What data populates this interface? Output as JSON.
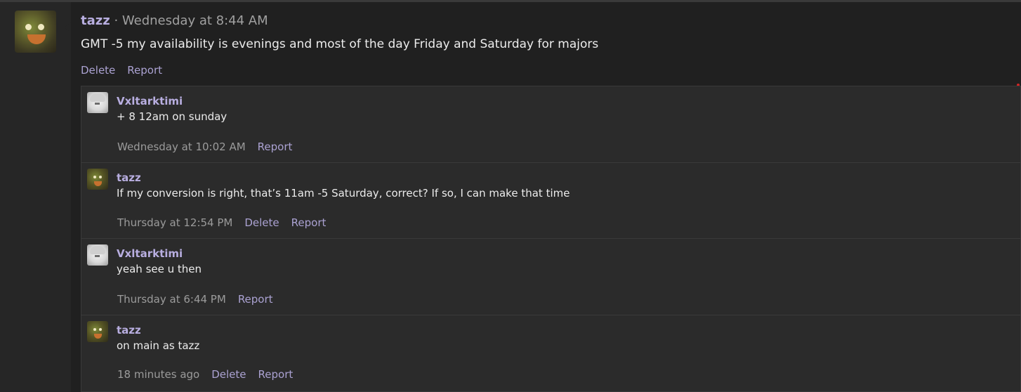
{
  "post": {
    "author": "tazz",
    "separator": " · ",
    "time": "Wednesday at 8:44 AM",
    "text": "GMT -5 my availability is evenings and most of the day Friday and Saturday for majors",
    "actions": {
      "delete": "Delete",
      "report": "Report"
    }
  },
  "replies": [
    {
      "author": "Vxltarktimi",
      "text": " + 8 12am on sunday",
      "time": "Wednesday at 10:02 AM",
      "report": "Report"
    },
    {
      "author": "tazz",
      "text": "If my conversion is right, that’s 11am -5 Saturday, correct? If so, I can make that time",
      "time": "Thursday at 12:54 PM",
      "delete": "Delete",
      "report": "Report"
    },
    {
      "author": "Vxltarktimi",
      "text": "yeah see u then",
      "time": "Thursday at 6:44 PM",
      "report": "Report"
    },
    {
      "author": "tazz",
      "text": "on main as tazz",
      "time": "18 minutes ago",
      "delete": "Delete",
      "report": "Report"
    }
  ]
}
